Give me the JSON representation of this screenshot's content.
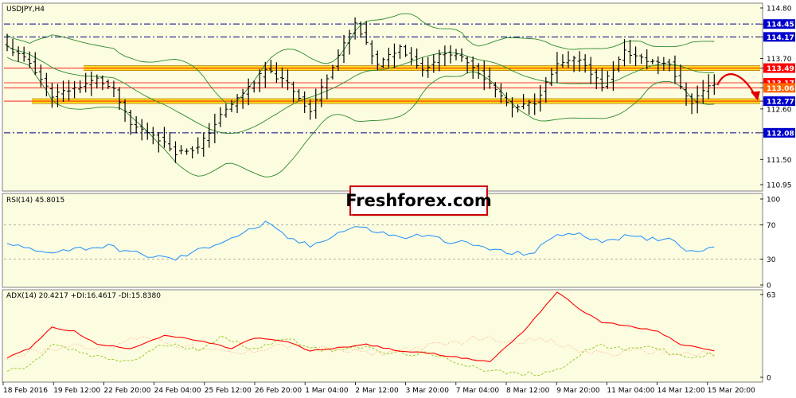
{
  "chart_data": {
    "type": "candlestick",
    "symbol_title": "USDJPY,H4",
    "watermark": "Freshforex.com",
    "colors": {
      "background": "#ffffff",
      "panel": "#fcfce0",
      "candles": "#000000",
      "bollinger": "#2e8b2e",
      "resistance_zone": "#ffd700",
      "support_zone": "#ffd700",
      "red_level": "#ff0000",
      "dashdot_level": "#000080",
      "badge_blue": "#0000cc",
      "badge_red": "#ff0000",
      "badge_orange": "#ff6600",
      "rsi_line": "#1e90ff",
      "adx_line": "#ff0000",
      "plus_di": "#9acd32",
      "minus_di": "#ffa07a",
      "arrow": "#dd0000",
      "watermark_border": "#cc0000"
    },
    "price_axis": {
      "ticks": [
        "114.80",
        "114.45",
        "114.17",
        "113.70",
        "113.49",
        "113.17",
        "113.06",
        "112.77",
        "112.60",
        "112.08",
        "111.50",
        "110.95"
      ]
    },
    "levels": [
      {
        "price": 114.45,
        "label": "114.45",
        "style": "dashdot",
        "badge": "blue"
      },
      {
        "price": 114.17,
        "label": "114.17",
        "style": "dashdot",
        "badge": "blue"
      },
      {
        "price": 113.49,
        "label": "113.49",
        "style": "zone",
        "badge": "red"
      },
      {
        "price": 113.17,
        "label": "113.17",
        "style": "red",
        "badge": "red"
      },
      {
        "price": 113.06,
        "label": "113.06",
        "style": "red",
        "badge": "orange"
      },
      {
        "price": 112.77,
        "label": "112.77",
        "style": "zone",
        "badge": "blue"
      },
      {
        "price": 112.08,
        "label": "112.08",
        "style": "dashdot",
        "badge": "blue"
      }
    ],
    "x_labels": [
      "18 Feb 2016",
      "19 Feb 12:00",
      "22 Feb 20:00",
      "24 Feb 04:00",
      "25 Feb 12:00",
      "26 Feb 20:00",
      "1 Mar 04:00",
      "2 Mar 12:00",
      "3 Mar 20:00",
      "7 Mar 04:00",
      "8 Mar 12:00",
      "9 Mar 20:00",
      "11 Mar 04:00",
      "14 Mar 12:00",
      "15 Mar 20:00"
    ],
    "price_keyframes": [
      [
        0,
        113.95
      ],
      [
        4,
        113.6
      ],
      [
        8,
        112.9
      ],
      [
        12,
        113.05
      ],
      [
        16,
        113.25
      ],
      [
        19,
        113.0
      ],
      [
        22,
        112.25
      ],
      [
        26,
        112.05
      ],
      [
        30,
        111.65
      ],
      [
        34,
        111.75
      ],
      [
        38,
        112.45
      ],
      [
        42,
        112.95
      ],
      [
        46,
        113.45
      ],
      [
        50,
        113.15
      ],
      [
        54,
        112.55
      ],
      [
        58,
        113.55
      ],
      [
        62,
        114.45
      ],
      [
        66,
        113.55
      ],
      [
        70,
        113.95
      ],
      [
        74,
        113.45
      ],
      [
        78,
        113.85
      ],
      [
        82,
        113.65
      ],
      [
        86,
        113.15
      ],
      [
        90,
        112.6
      ],
      [
        94,
        112.75
      ],
      [
        98,
        113.55
      ],
      [
        102,
        113.7
      ],
      [
        106,
        113.1
      ],
      [
        110,
        113.85
      ],
      [
        114,
        113.65
      ],
      [
        118,
        113.6
      ],
      [
        120,
        113.05
      ],
      [
        122,
        112.75
      ],
      [
        124,
        113.0
      ],
      [
        126,
        113.17
      ]
    ],
    "rsi": {
      "label": "RSI(14) 45.8015",
      "scale": [
        "100",
        "70",
        "30",
        "0"
      ],
      "levels": [
        70,
        30
      ],
      "keyframes": [
        [
          0,
          48
        ],
        [
          6,
          38
        ],
        [
          12,
          42
        ],
        [
          18,
          45
        ],
        [
          24,
          35
        ],
        [
          30,
          30
        ],
        [
          34,
          40
        ],
        [
          38,
          50
        ],
        [
          42,
          60
        ],
        [
          46,
          72
        ],
        [
          50,
          55
        ],
        [
          54,
          45
        ],
        [
          58,
          58
        ],
        [
          62,
          68
        ],
        [
          66,
          62
        ],
        [
          70,
          55
        ],
        [
          74,
          58
        ],
        [
          78,
          52
        ],
        [
          82,
          48
        ],
        [
          86,
          42
        ],
        [
          90,
          36
        ],
        [
          94,
          38
        ],
        [
          98,
          60
        ],
        [
          102,
          58
        ],
        [
          106,
          52
        ],
        [
          110,
          56
        ],
        [
          114,
          53
        ],
        [
          118,
          55
        ],
        [
          122,
          38
        ],
        [
          126,
          46
        ]
      ]
    },
    "adx": {
      "label": "ADX(14) 20.4217 +DI:16.4617 -DI:15.8380",
      "scale": [
        "63",
        "0"
      ],
      "adx_keyframes": [
        [
          0,
          15
        ],
        [
          4,
          22
        ],
        [
          8,
          38
        ],
        [
          12,
          35
        ],
        [
          16,
          25
        ],
        [
          22,
          22
        ],
        [
          28,
          32
        ],
        [
          34,
          28
        ],
        [
          40,
          22
        ],
        [
          44,
          30
        ],
        [
          50,
          27
        ],
        [
          54,
          20
        ],
        [
          58,
          22
        ],
        [
          64,
          25
        ],
        [
          70,
          20
        ],
        [
          76,
          18
        ],
        [
          82,
          14
        ],
        [
          86,
          12
        ],
        [
          92,
          35
        ],
        [
          98,
          65
        ],
        [
          102,
          52
        ],
        [
          106,
          42
        ],
        [
          112,
          38
        ],
        [
          116,
          35
        ],
        [
          120,
          25
        ],
        [
          124,
          22
        ],
        [
          126,
          20
        ]
      ],
      "plus_di_keyframes": [
        [
          0,
          5
        ],
        [
          4,
          8
        ],
        [
          8,
          25
        ],
        [
          12,
          20
        ],
        [
          16,
          15
        ],
        [
          22,
          12
        ],
        [
          28,
          25
        ],
        [
          34,
          22
        ],
        [
          38,
          30
        ],
        [
          44,
          22
        ],
        [
          50,
          30
        ],
        [
          56,
          20
        ],
        [
          62,
          24
        ],
        [
          68,
          18
        ],
        [
          74,
          18
        ],
        [
          80,
          12
        ],
        [
          86,
          5
        ],
        [
          92,
          2
        ],
        [
          98,
          5
        ],
        [
          102,
          18
        ],
        [
          106,
          25
        ],
        [
          110,
          20
        ],
        [
          114,
          25
        ],
        [
          118,
          18
        ],
        [
          122,
          15
        ],
        [
          126,
          18
        ]
      ],
      "minus_di_keyframes": [
        [
          0,
          16
        ],
        [
          6,
          20
        ],
        [
          12,
          25
        ],
        [
          18,
          22
        ],
        [
          24,
          32
        ],
        [
          30,
          25
        ],
        [
          36,
          20
        ],
        [
          42,
          18
        ],
        [
          48,
          25
        ],
        [
          54,
          22
        ],
        [
          60,
          20
        ],
        [
          66,
          18
        ],
        [
          72,
          22
        ],
        [
          78,
          25
        ],
        [
          84,
          30
        ],
        [
          90,
          28
        ],
        [
          96,
          28
        ],
        [
          102,
          20
        ],
        [
          108,
          18
        ],
        [
          114,
          20
        ],
        [
          120,
          18
        ],
        [
          126,
          17
        ]
      ]
    }
  }
}
